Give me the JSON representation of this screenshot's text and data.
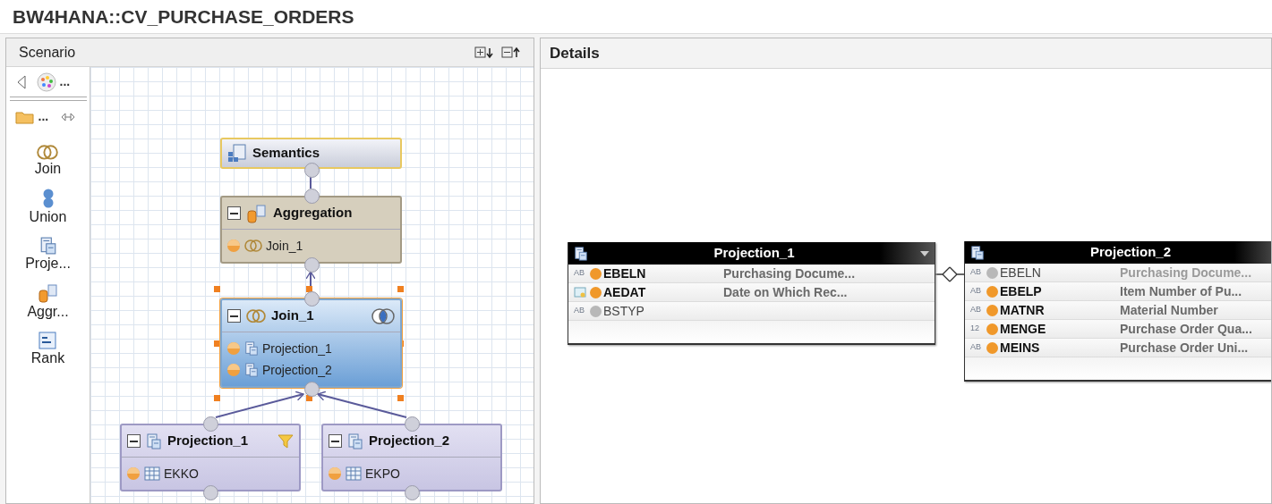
{
  "window": {
    "title": "BW4HANA::CV_PURCHASE_ORDERS"
  },
  "scenario": {
    "title": "Scenario",
    "palette_toolbar": [
      {
        "kind": "palette",
        "label": "..."
      },
      {
        "kind": "folder",
        "label": "..."
      }
    ],
    "palette_items": [
      {
        "kind": "join",
        "label": "Join"
      },
      {
        "kind": "union",
        "label": "Union"
      },
      {
        "kind": "projection",
        "label": "Proje..."
      },
      {
        "kind": "aggregation",
        "label": "Aggr..."
      },
      {
        "kind": "rank",
        "label": "Rank"
      }
    ],
    "nodes": [
      {
        "kind": "semantics",
        "title": "Semantics",
        "selected": false,
        "filter": false
      },
      {
        "kind": "aggregation",
        "title": "Aggregation",
        "selected": false,
        "filter": false,
        "rows": [
          {
            "kind": "join",
            "label": "Join_1"
          }
        ]
      },
      {
        "kind": "join",
        "title": "Join_1",
        "selected": true,
        "filter": false,
        "rows": [
          {
            "kind": "projection",
            "label": "Projection_1"
          },
          {
            "kind": "projection",
            "label": "Projection_2"
          }
        ]
      },
      {
        "kind": "projection",
        "title": "Projection_1",
        "selected": false,
        "filter": true,
        "rows": [
          {
            "kind": "table",
            "label": "EKKO"
          }
        ]
      },
      {
        "kind": "projection",
        "title": "Projection_2",
        "selected": false,
        "filter": false,
        "rows": [
          {
            "kind": "table",
            "label": "EKPO"
          }
        ]
      }
    ]
  },
  "details": {
    "title": "Details",
    "tables": [
      {
        "title": "Projection_1",
        "menu": true,
        "columns": [
          {
            "kind": "char",
            "type_label": "AB",
            "mapped": true,
            "name": "EBELN",
            "description": "Purchasing Docume..."
          },
          {
            "kind": "date",
            "mapped": true,
            "name": "AEDAT",
            "description": "Date on Which Rec..."
          },
          {
            "kind": "char",
            "type_label": "AB",
            "mapped": false,
            "name": "BSTYP"
          }
        ]
      },
      {
        "title": "Projection_2",
        "menu": false,
        "columns": [
          {
            "kind": "char",
            "type_label": "AB",
            "mapped": false,
            "name": "EBELN",
            "description": "Purchasing Docume..."
          },
          {
            "kind": "char",
            "type_label": "AB",
            "mapped": true,
            "name": "EBELP",
            "description": "Item Number of Pu..."
          },
          {
            "kind": "char",
            "type_label": "AB",
            "mapped": true,
            "name": "MATNR",
            "description": "Material Number"
          },
          {
            "kind": "number",
            "type_label": "12",
            "mapped": true,
            "name": "MENGE",
            "description": "Purchase Order Qua..."
          },
          {
            "kind": "char",
            "type_label": "AB",
            "mapped": true,
            "name": "MEINS",
            "description": "Purchase Order Uni..."
          }
        ]
      }
    ]
  }
}
